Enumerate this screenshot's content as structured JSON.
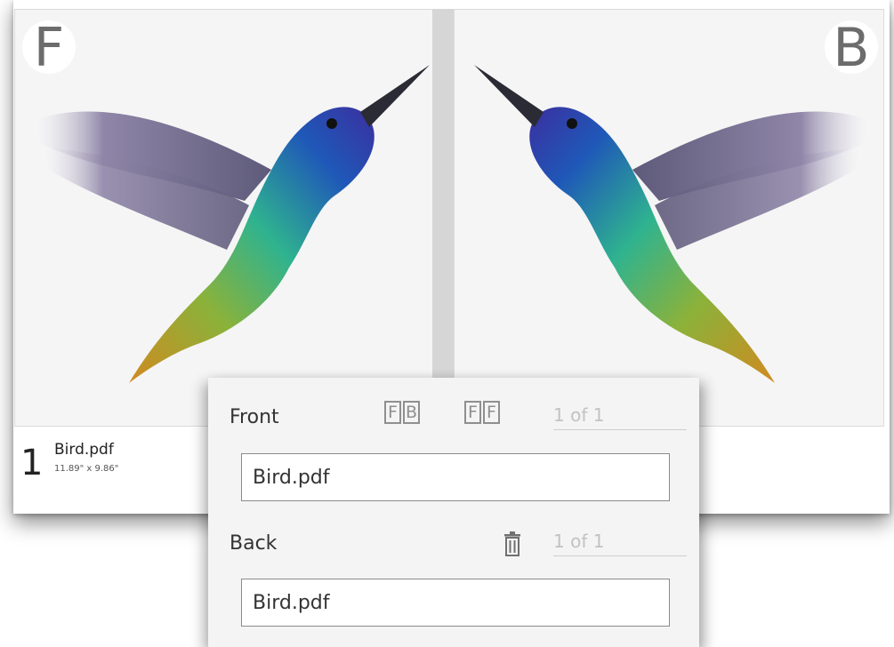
{
  "card": {
    "front_badge": "F",
    "back_badge": "B",
    "index": "1",
    "file_name": "Bird.pdf",
    "file_size": "11.89\" x 9.86\""
  },
  "popup": {
    "front_label": "Front",
    "back_label": "Back",
    "front_counter": "1 of 1",
    "back_counter": "1 of 1",
    "front_value": "Bird.pdf",
    "back_value": "Bird.pdf",
    "layout_icon_fb": [
      "F",
      "B"
    ],
    "layout_icon_ff": [
      "F",
      "F"
    ]
  },
  "icons": {
    "trash": "trash-icon"
  }
}
